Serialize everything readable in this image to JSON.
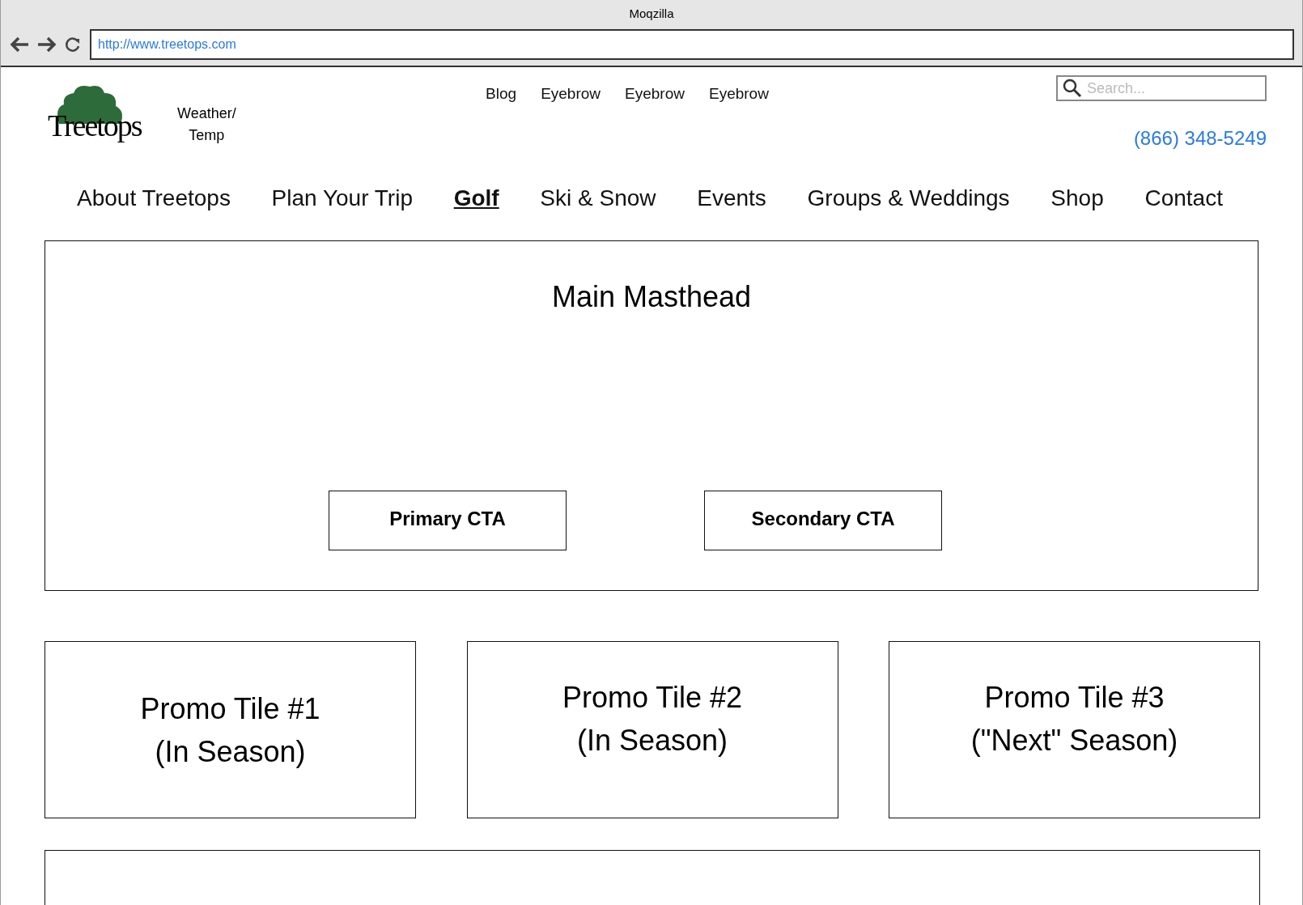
{
  "window": {
    "title": "Moqzilla"
  },
  "address_bar": {
    "url": "http://www.treetops.com"
  },
  "header": {
    "logo_text": "Treetops",
    "weather": [
      "Weather/",
      "Temp"
    ],
    "eyebrow_links": [
      "Blog",
      "Eyebrow",
      "Eyebrow",
      "Eyebrow"
    ],
    "search": {
      "placeholder": "Search..."
    },
    "phone": "(866) 348-5249"
  },
  "nav": [
    {
      "label": "About Treetops",
      "selected": false
    },
    {
      "label": "Plan Your Trip",
      "selected": false
    },
    {
      "label": "Golf",
      "selected": true
    },
    {
      "label": "Ski & Snow",
      "selected": false
    },
    {
      "label": "Events",
      "selected": false
    },
    {
      "label": "Groups & Weddings",
      "selected": false
    },
    {
      "label": "Shop",
      "selected": false
    },
    {
      "label": "Contact",
      "selected": false
    }
  ],
  "masthead": {
    "title": "Main Masthead",
    "buttons": [
      "Primary CTA",
      "Secondary CTA"
    ]
  },
  "promo_tiles": [
    [
      "Promo Tile #1",
      "(In Season)"
    ],
    [
      "Promo Tile #2",
      "(In Season)"
    ],
    [
      "Promo Tile #3",
      "(\"Next\" Season)"
    ]
  ]
}
